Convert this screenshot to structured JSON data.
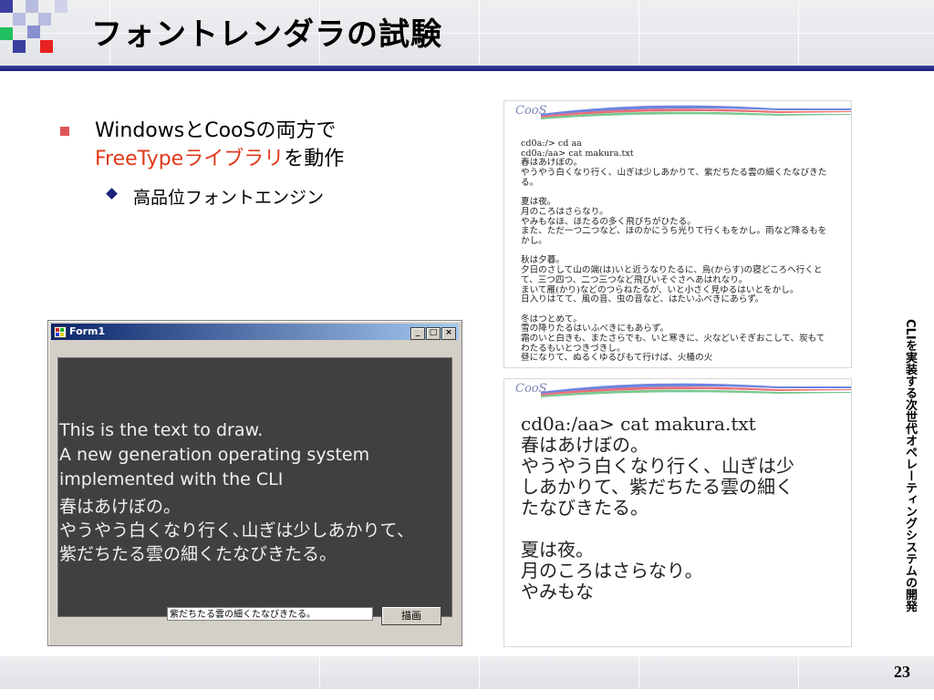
{
  "slide": {
    "title": "フォントレンダラの試験",
    "page_number": "23",
    "vertical_caption": "CLIを実装する次世代オペレーティングシステムの開発"
  },
  "bullets": {
    "level1": {
      "line1": "WindowsとCooSの両方で",
      "line2_red": "FreeTypeライブラリ",
      "line2_rest": "を動作"
    },
    "level2": "高品位フォントエンジン"
  },
  "form_window": {
    "title": "Form1",
    "buttons": [
      "_",
      "□",
      "×"
    ],
    "canvas_lines": [
      "This is the text to draw.",
      "A new generation operating system",
      "implemented with the CLI",
      "春はあけぼの。",
      "やうやう白くなり行く､山ぎは少しあかりて､",
      "紫だちたる雲の細くたなびきたる。"
    ],
    "input_value": "紫だちたる雲の細くたなびきたる。",
    "draw_button": "描画"
  },
  "terminal_small": {
    "logo": "CooS",
    "text": "cd0a:/> cd aa\ncd0a:/aa> cat makura.txt\n春はあけぼの。\nやうやう白くなり行く、山ぎは少しあかりて、紫だちたる雲の細くたなびきた\nる。\n\n夏は夜。\n月のころはさらなり。\nやみもなほ、ほたるの多く飛びちがひたる。\nまた、ただ一つ二つなど、ほのかにうち光りて行くもをかし。雨など降るもを\nかし。\n\n秋は夕暮。\n夕日のさして山の端(は)いと近うなりたるに、烏(からす)の寝どころへ行くと\nて、三つ四つ、二つ三つなど飛びいそぐさへあはれなり。\nまいて雁(かり)などのつらねたるが、いと小さく見ゆるはいとをかし。\n日入りはてて、風の音、虫の音など、はたいふべきにあらず。\n\n冬はつとめて。\n雪の降りたるはいふべきにもあらず。\n霜のいと白きも、またさらでも、いと寒きに、火などいそぎおこして、炭もて\nわたるもいとつきづきし。\n昼になりて、ぬるくゆるびもて行けば、火桶の火"
  },
  "terminal_large": {
    "logo": "CooS",
    "text": "cd0a:/aa> cat makura.txt\n春はあけぼの。\nやうやう白くなり行く、山ぎは少\nしあかりて、紫だちたる雲の細く\nたなびきたる。\n\n夏は夜。\n月のころはさらなり。\nやみもな"
  },
  "colors": {
    "title_rule": "#1c217a",
    "bullet_red": "#e03a1a",
    "canvas_bg": "#404040"
  }
}
